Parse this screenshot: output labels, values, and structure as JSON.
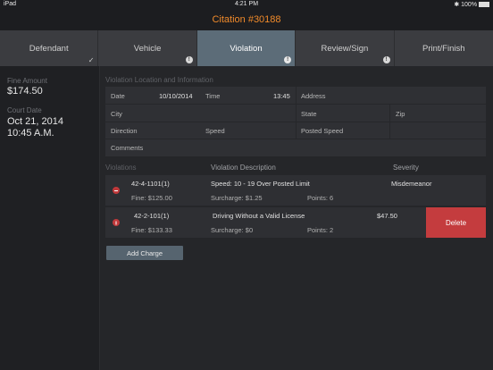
{
  "status": {
    "device": "iPad",
    "time": "4:21 PM",
    "battery": "100%"
  },
  "title": "Citation #30188",
  "tabs": [
    {
      "label": "Defendant"
    },
    {
      "label": "Vehicle"
    },
    {
      "label": "Violation"
    },
    {
      "label": "Review/Sign"
    },
    {
      "label": "Print/Finish"
    }
  ],
  "left": {
    "fine_label": "Fine Amount",
    "fine_value": "$174.50",
    "court_label": "Court Date",
    "court_date": "Oct 21, 2014",
    "court_time": "10:45 A.M."
  },
  "location": {
    "title": "Violation Location and Information",
    "date_label": "Date",
    "date_value": "10/10/2014",
    "time_label": "Time",
    "time_value": "13:45",
    "address_label": "Address",
    "city_label": "City",
    "state_label": "State",
    "zip_label": "Zip",
    "direction_label": "Direction",
    "speed_label": "Speed",
    "posted_label": "Posted Speed",
    "comments_label": "Comments"
  },
  "violations": {
    "title": "Violations",
    "col_desc": "Violation Description",
    "col_severity": "Severity",
    "rows": [
      {
        "code": "42-4-1101(1)",
        "desc": "Speed: 10 - 19 Over Posted Limit",
        "severity": "Misdemeanor",
        "fine": "Fine: $125.00",
        "surcharge": "Surcharge: $1.25",
        "points": "Points: 6"
      },
      {
        "code": "42-2-101(1)",
        "desc": "Driving Without a Valid License",
        "amount": "$47.50",
        "fine": "Fine: $133.33",
        "surcharge": "Surcharge: $0",
        "points": "Points: 2"
      }
    ],
    "delete_label": "Delete",
    "add_label": "Add Charge"
  }
}
